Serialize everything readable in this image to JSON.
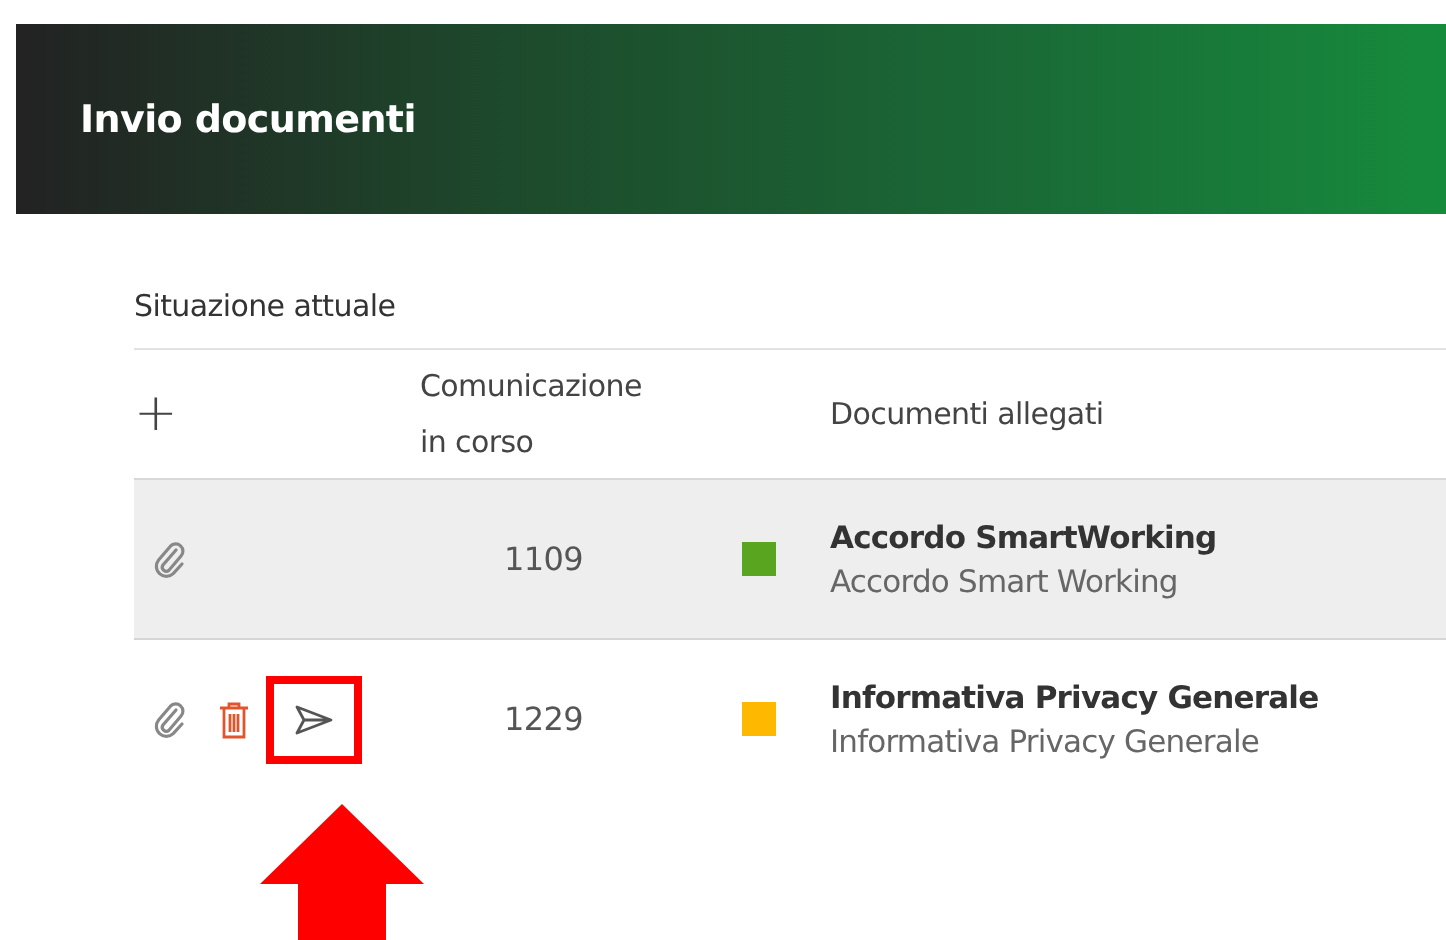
{
  "header": {
    "title": "Invio documenti"
  },
  "section": {
    "title": "Situazione attuale"
  },
  "table": {
    "add_symbol": "+",
    "columns": [
      "Comunicazione in corso",
      "Documenti allegati"
    ],
    "rows": [
      {
        "selected": true,
        "number": "1109",
        "color": "#5aa51f",
        "title": "Accordo SmartWorking",
        "subtitle": "Accordo Smart Working",
        "actions": [
          {
            "kind": "attach",
            "highlighted": false
          }
        ]
      },
      {
        "selected": false,
        "number": "1229",
        "color": "#ffb800",
        "title": "Informativa Privacy Generale",
        "subtitle": "Informativa Privacy Generale",
        "actions": [
          {
            "kind": "attach",
            "highlighted": false
          },
          {
            "kind": "delete",
            "highlighted": false
          },
          {
            "kind": "send",
            "highlighted": true
          }
        ]
      }
    ]
  }
}
